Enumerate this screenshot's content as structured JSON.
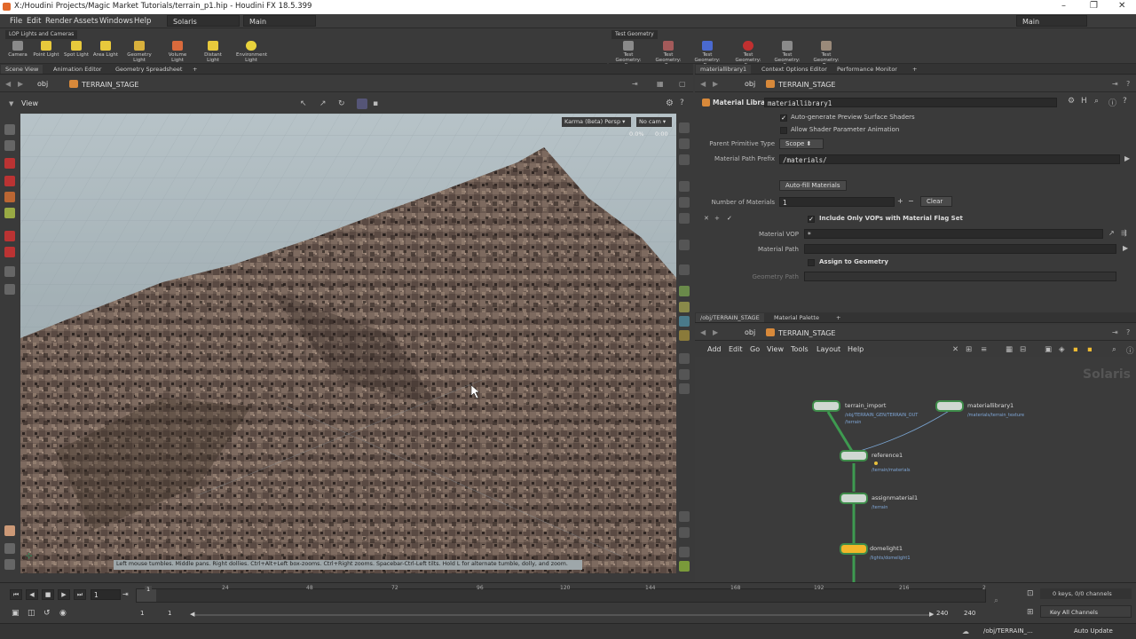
{
  "window": {
    "title": "X:/Houdini Projects/Magic Market Tutorials/terrain_p1.hip - Houdini FX 18.5.399"
  },
  "menu": {
    "items": [
      "File",
      "Edit",
      "Render",
      "Assets",
      "Windows",
      "Help"
    ],
    "desktop": "Solaris",
    "layout": "Main",
    "right_layout": "Main"
  },
  "shelf_left": {
    "tab": "LOP Lights and Cameras",
    "tools": [
      "Camera",
      "Point Light",
      "Spot Light",
      "Area Light",
      "Geometry Light",
      "Volume Light",
      "Distant Light",
      "Environment Light"
    ]
  },
  "shelf_right": {
    "tab": "Test Geometry",
    "tools": [
      "Test Geometry: C...",
      "Test Geometry: P...",
      "Test Geometry: R...",
      "Test Geometry: S...",
      "Test Geometry: S...",
      "Test Geometry: T..."
    ]
  },
  "left_tabs": [
    "Scene View",
    "Animation Editor",
    "Geometry Spreadsheet"
  ],
  "right_tabs": [
    "materiallibrary1",
    "Context Options Editor",
    "Performance Monitor"
  ],
  "left_path": {
    "context": "obj",
    "node": "TERRAIN_STAGE"
  },
  "viewport": {
    "label": "View",
    "renderer": "Karma (Beta) Persp",
    "camera": "No cam",
    "progress": "0.0%",
    "time": "0:00",
    "hint": "Left mouse tumbles. Middle pans. Right dollies. Ctrl+Alt+Left box-zooms. Ctrl+Right zooms. Spacebar-Ctrl-Left tilts. Hold L for alternate tumble, dolly, and zoom."
  },
  "params": {
    "path": {
      "context": "obj",
      "node": "TERRAIN_STAGE"
    },
    "type": "Material Library",
    "name": "materiallibrary1",
    "auto_preview": "Auto-generate Preview Surface Shaders",
    "allow_anim": "Allow Shader Parameter Animation",
    "parent_prim_label": "Parent Primitive Type",
    "parent_prim_value": "Scope",
    "mat_prefix_label": "Material Path Prefix",
    "mat_prefix_value": "/materials/",
    "autofill": "Auto-fill Materials",
    "num_label": "Number of Materials",
    "num_value": "1",
    "clear": "Clear",
    "include_only": "Include Only VOPs with Material Flag Set",
    "mat_vop_label": "Material VOP",
    "mat_vop_value": "*",
    "mat_path_label": "Material Path",
    "assign": "Assign to Geometry",
    "geo_path_label": "Geometry Path"
  },
  "net_tabs": [
    "/obj/TERRAIN_STAGE",
    "Material Palette"
  ],
  "net_path": {
    "context": "obj",
    "node": "TERRAIN_STAGE"
  },
  "net_menu": [
    "Add",
    "Edit",
    "Go",
    "View",
    "Tools",
    "Layout",
    "Help"
  ],
  "net_watermark": "Solaris",
  "nodes": [
    {
      "name": "terrain_import",
      "sub1": "/obj/TERRAIN_GEN/TERRAIN_OUT",
      "sub2": "/terrain"
    },
    {
      "name": "materiallibrary1",
      "sub1": "/materials/terrain_texture"
    },
    {
      "name": "reference1",
      "sub1": "/terrain/materials"
    },
    {
      "name": "assignmaterial1",
      "sub1": "/terrain"
    },
    {
      "name": "domelight1",
      "sub1": "/lights/domelight1"
    }
  ],
  "timeline": {
    "frame": "1",
    "ticks": [
      "24",
      "48",
      "72",
      "96",
      "120",
      "144",
      "168",
      "192",
      "216",
      "2"
    ],
    "marker": "1",
    "start": "1",
    "start2": "1",
    "end": "240",
    "end2": "240",
    "keys": "0 keys, 0/0 channels",
    "key_all": "Key All Channels"
  },
  "status": {
    "path": "/obj/TERRAIN_...",
    "auto": "Auto Update"
  }
}
